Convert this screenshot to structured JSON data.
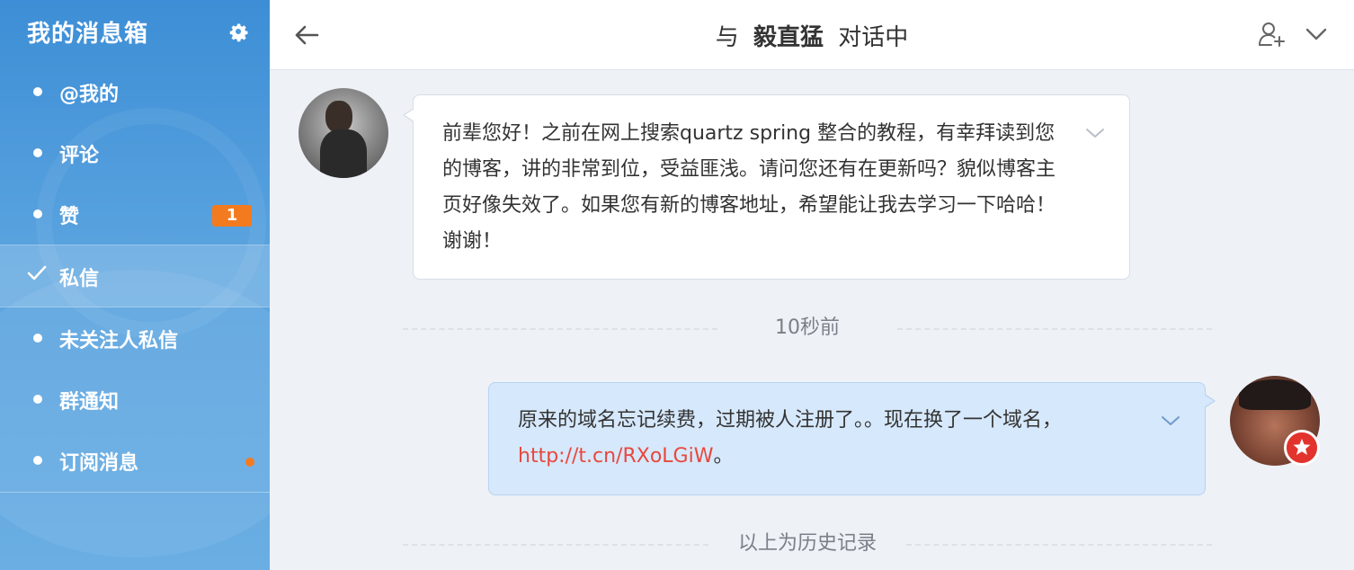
{
  "sidebar": {
    "title": "我的消息箱",
    "settings_icon": "gear-icon",
    "items": [
      {
        "label": "@我的"
      },
      {
        "label": "评论"
      },
      {
        "label": "赞",
        "badge": "1"
      },
      {
        "label": "私信",
        "active": true
      },
      {
        "label": "未关注人私信"
      },
      {
        "label": "群通知"
      },
      {
        "label": "订阅消息",
        "new_dot": true
      }
    ]
  },
  "header": {
    "prefix": "与",
    "contact_name": "毅直猛",
    "suffix": "对话中",
    "back_icon": "arrow-left-icon",
    "add_user_icon": "add-user-icon",
    "dropdown_icon": "chevron-down-icon"
  },
  "messages": [
    {
      "direction": "incoming",
      "text": "前辈您好！之前在网上搜索quartz spring 整合的教程，有幸拜读到您的博客，讲的非常到位，受益匪浅。请问您还有在更新吗？貌似博客主页好像失效了。如果您有新的博客地址，希望能让我去学习一下哈哈！谢谢！"
    },
    {
      "direction": "outgoing",
      "text_before": "原来的域名忘记续费，过期被人注册了。。现在换了一个域名，",
      "link": "http://t.cn/RXoLGiW",
      "text_after": "。"
    }
  ],
  "separators": {
    "time": "10秒前",
    "history": "以上为历史记录"
  },
  "colors": {
    "sidebar_top": "#3d8ed6",
    "badge": "#f47a1f",
    "link": "#e8483d",
    "outgoing_bubble": "#d6e8fb"
  }
}
